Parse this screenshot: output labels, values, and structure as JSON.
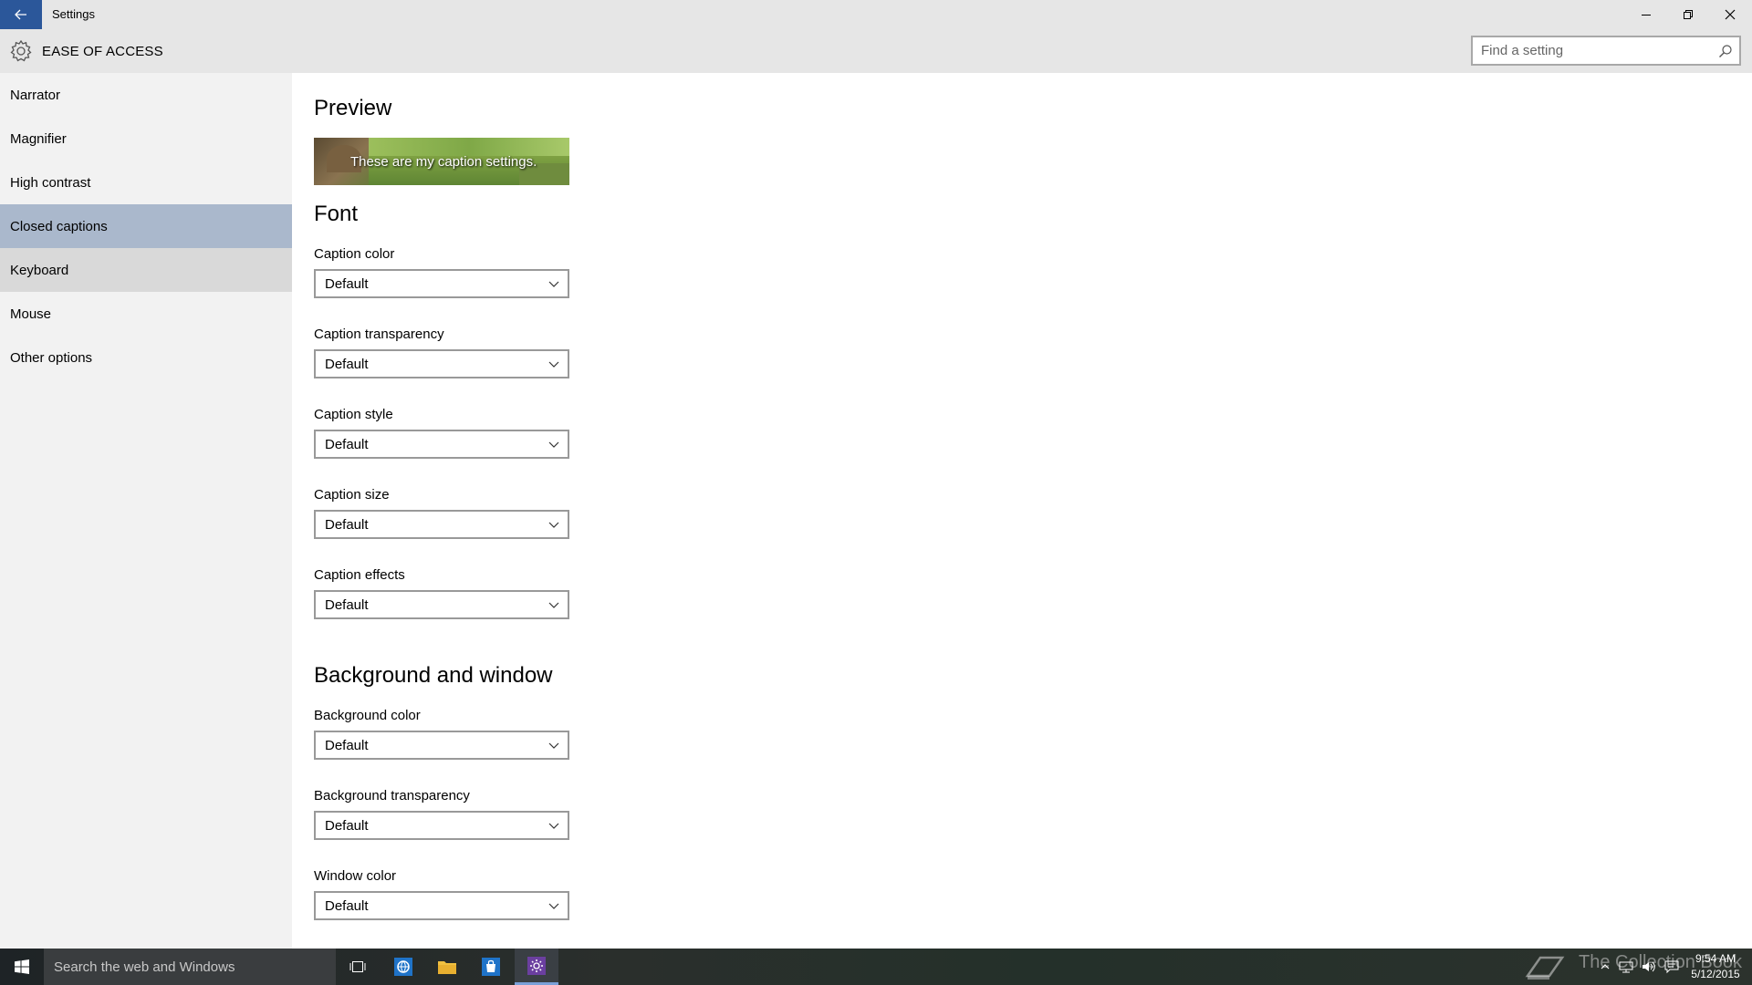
{
  "window": {
    "title": "Settings",
    "controls": {
      "minimize": "minimize-icon",
      "restore": "restore-icon",
      "close": "close-icon"
    }
  },
  "header": {
    "title": "EASE OF ACCESS",
    "icon": "gear-icon",
    "search_placeholder": "Find a setting"
  },
  "sidebar": {
    "items": [
      {
        "label": "Narrator"
      },
      {
        "label": "Magnifier"
      },
      {
        "label": "High contrast"
      },
      {
        "label": "Closed captions",
        "selected": true
      },
      {
        "label": "Keyboard",
        "hovered": true
      },
      {
        "label": "Mouse"
      },
      {
        "label": "Other options"
      }
    ]
  },
  "main": {
    "preview": {
      "title": "Preview",
      "caption": "These are my caption settings."
    },
    "font": {
      "title": "Font",
      "fields": [
        {
          "label": "Caption color",
          "value": "Default"
        },
        {
          "label": "Caption transparency",
          "value": "Default"
        },
        {
          "label": "Caption style",
          "value": "Default"
        },
        {
          "label": "Caption size",
          "value": "Default"
        },
        {
          "label": "Caption effects",
          "value": "Default"
        }
      ]
    },
    "background": {
      "title": "Background and window",
      "fields": [
        {
          "label": "Background color",
          "value": "Default"
        },
        {
          "label": "Background transparency",
          "value": "Default"
        },
        {
          "label": "Window color",
          "value": "Default"
        }
      ]
    }
  },
  "taskbar": {
    "search_placeholder": "Search the web and Windows",
    "watermark": "The Collection Book",
    "clock": {
      "time": "9:54 AM",
      "date": "5/12/2015"
    }
  },
  "colors": {
    "accent": "#2b579a",
    "selected_nav": "#aab8cc",
    "sidebar_bg": "#f2f2f2",
    "header_bg": "#e6e6e6"
  }
}
